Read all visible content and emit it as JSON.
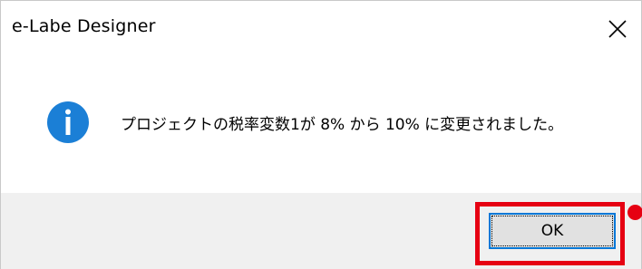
{
  "window": {
    "title": "e-Labe Designer",
    "close_icon": "close-icon"
  },
  "dialog": {
    "icon": "info-icon",
    "icon_color": "#1b7fd6",
    "message": "プロジェクトの税率変数1が 8% から 10% に変更されました。"
  },
  "buttons": {
    "ok_label": "OK"
  },
  "colors": {
    "highlight": "#e60012",
    "button_focus_border": "#0078d7",
    "footer_background": "#f0f0f0"
  }
}
